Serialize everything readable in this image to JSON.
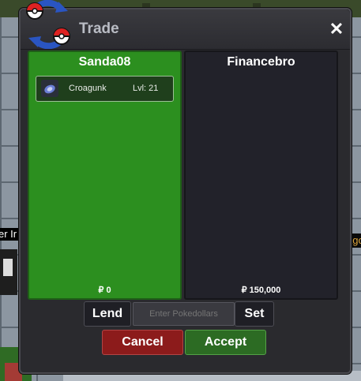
{
  "world": {
    "label_left": "er Ir",
    "label_right": "ago"
  },
  "window": {
    "title": "Trade",
    "close_glyph": "✕",
    "icon": "trade-pokeball-arrows-icon"
  },
  "left_panel": {
    "name": "Sanda08",
    "items": [
      {
        "icon": "croagunk-icon",
        "name": "Croagunk",
        "level": "Lvl: 21"
      }
    ],
    "money": "₽ 0"
  },
  "right_panel": {
    "name": "Financebro",
    "items": [],
    "money": "₽ 150,000"
  },
  "controls": {
    "lend_label": "Lend",
    "input_placeholder": "Enter Pokedollars",
    "set_label": "Set",
    "cancel_label": "Cancel",
    "accept_label": "Accept"
  },
  "colors": {
    "left_panel_bg": "#2c8f1f",
    "right_panel_bg": "#22222a",
    "cancel_bg": "#8c1b1b",
    "accept_bg": "#2c6b23"
  }
}
